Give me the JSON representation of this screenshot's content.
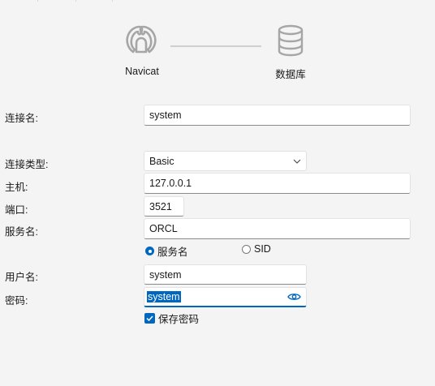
{
  "header": {
    "source_label": "Navicat",
    "target_label": "数据库"
  },
  "form": {
    "connection_name": {
      "label": "连接名:",
      "value": "system"
    },
    "connection_type": {
      "label": "连接类型:",
      "value": "Basic"
    },
    "host": {
      "label": "主机:",
      "value": "127.0.0.1"
    },
    "port": {
      "label": "端口:",
      "value": "3521"
    },
    "service_name": {
      "label": "服务名:",
      "value": "ORCL"
    },
    "service_type": {
      "options": [
        {
          "label": "服务名",
          "selected": true
        },
        {
          "label": "SID",
          "selected": false
        }
      ]
    },
    "username": {
      "label": "用户名:",
      "value": "system"
    },
    "password": {
      "label": "密码:",
      "value": "system",
      "text_selected": true
    },
    "save_password": {
      "label": "保存密码",
      "checked": true
    }
  },
  "colors": {
    "accent": "#0067c0",
    "background": "#f4f4f4",
    "icon_gray": "#a6a6a6"
  },
  "icons": {
    "source": "navicat-logo-icon",
    "target": "database-icon",
    "dropdown": "chevron-down-icon",
    "reveal_password": "eye-icon",
    "checkbox": "checkmark-icon"
  }
}
